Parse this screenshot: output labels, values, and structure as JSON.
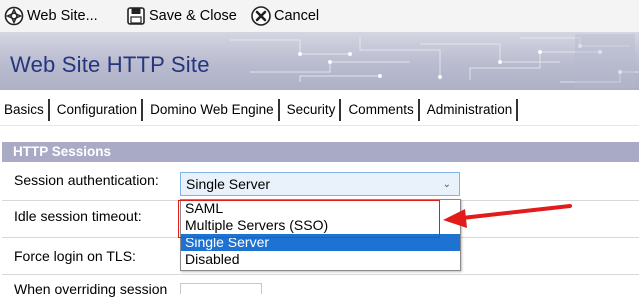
{
  "toolbar": {
    "buttons": [
      {
        "label": "Web Site...",
        "icon": "web-site-icon"
      },
      {
        "label": "Save & Close",
        "icon": "save-icon"
      },
      {
        "label": "Cancel",
        "icon": "cancel-icon"
      }
    ]
  },
  "banner": {
    "title": "Web Site HTTP Site"
  },
  "tabs": [
    "Basics",
    "Configuration",
    "Domino Web Engine",
    "Security",
    "Comments",
    "Administration"
  ],
  "section": {
    "title": "HTTP Sessions"
  },
  "fields": {
    "session_auth_label": "Session authentication:",
    "session_auth_value": "Single Server",
    "idle_timeout_label": "Idle session timeout:",
    "force_login_label": "Force login on TLS:",
    "overriding_label": "When overriding session"
  },
  "dropdown": {
    "options": [
      "SAML",
      "Multiple Servers (SSO)",
      "Single Server",
      "Disabled"
    ],
    "selected": "Single Server"
  },
  "colors": {
    "annotation": "#e21b1b",
    "selection": "#1e73d2",
    "section_bg": "#a9abc6",
    "title": "#26357d"
  }
}
